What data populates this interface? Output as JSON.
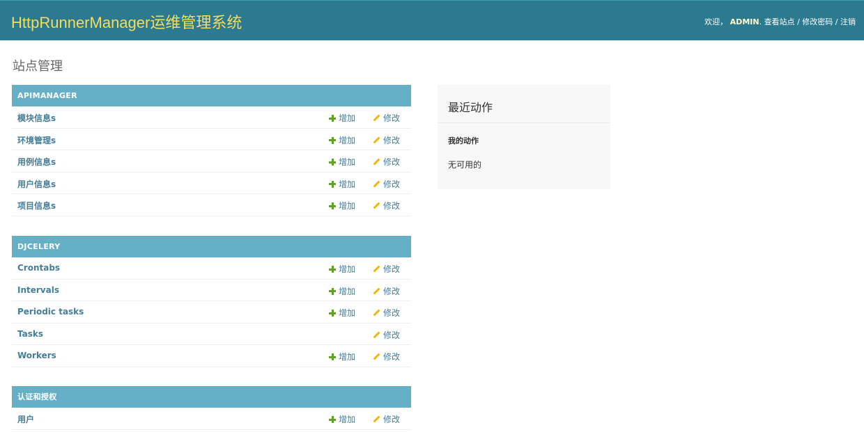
{
  "header": {
    "branding": "HttpRunnerManager运维管理系统",
    "welcome": "欢迎，",
    "username": "ADMIN",
    "view_site": "查看站点",
    "change_password": "修改密码",
    "logout": "注销",
    "separator": "/",
    "brand_color": "#f5dd5d",
    "background": "#2b7a8f"
  },
  "page_title": "站点管理",
  "actions": {
    "add": "增加",
    "change": "修改"
  },
  "modules": [
    {
      "caption": "APIMANAGER",
      "models": [
        {
          "name": "模块信息s",
          "add": true
        },
        {
          "name": "环境管理s",
          "add": true
        },
        {
          "name": "用例信息s",
          "add": true
        },
        {
          "name": "用户信息s",
          "add": true
        },
        {
          "name": "项目信息s",
          "add": true
        }
      ]
    },
    {
      "caption": "DJCELERY",
      "models": [
        {
          "name": "Crontabs",
          "add": true
        },
        {
          "name": "Intervals",
          "add": true
        },
        {
          "name": "Periodic tasks",
          "add": true
        },
        {
          "name": "Tasks",
          "add": false
        },
        {
          "name": "Workers",
          "add": true
        }
      ]
    },
    {
      "caption": "认证和授权",
      "models": [
        {
          "name": "用户",
          "add": true
        }
      ]
    }
  ],
  "recent_actions": {
    "title": "最近动作",
    "my_actions": "我的动作",
    "none_available": "无可用的"
  },
  "colors": {
    "module_caption": "#65afc7",
    "link": "#447e9b",
    "add_icon": "#5fa225",
    "change_icon": "#efb80b"
  }
}
